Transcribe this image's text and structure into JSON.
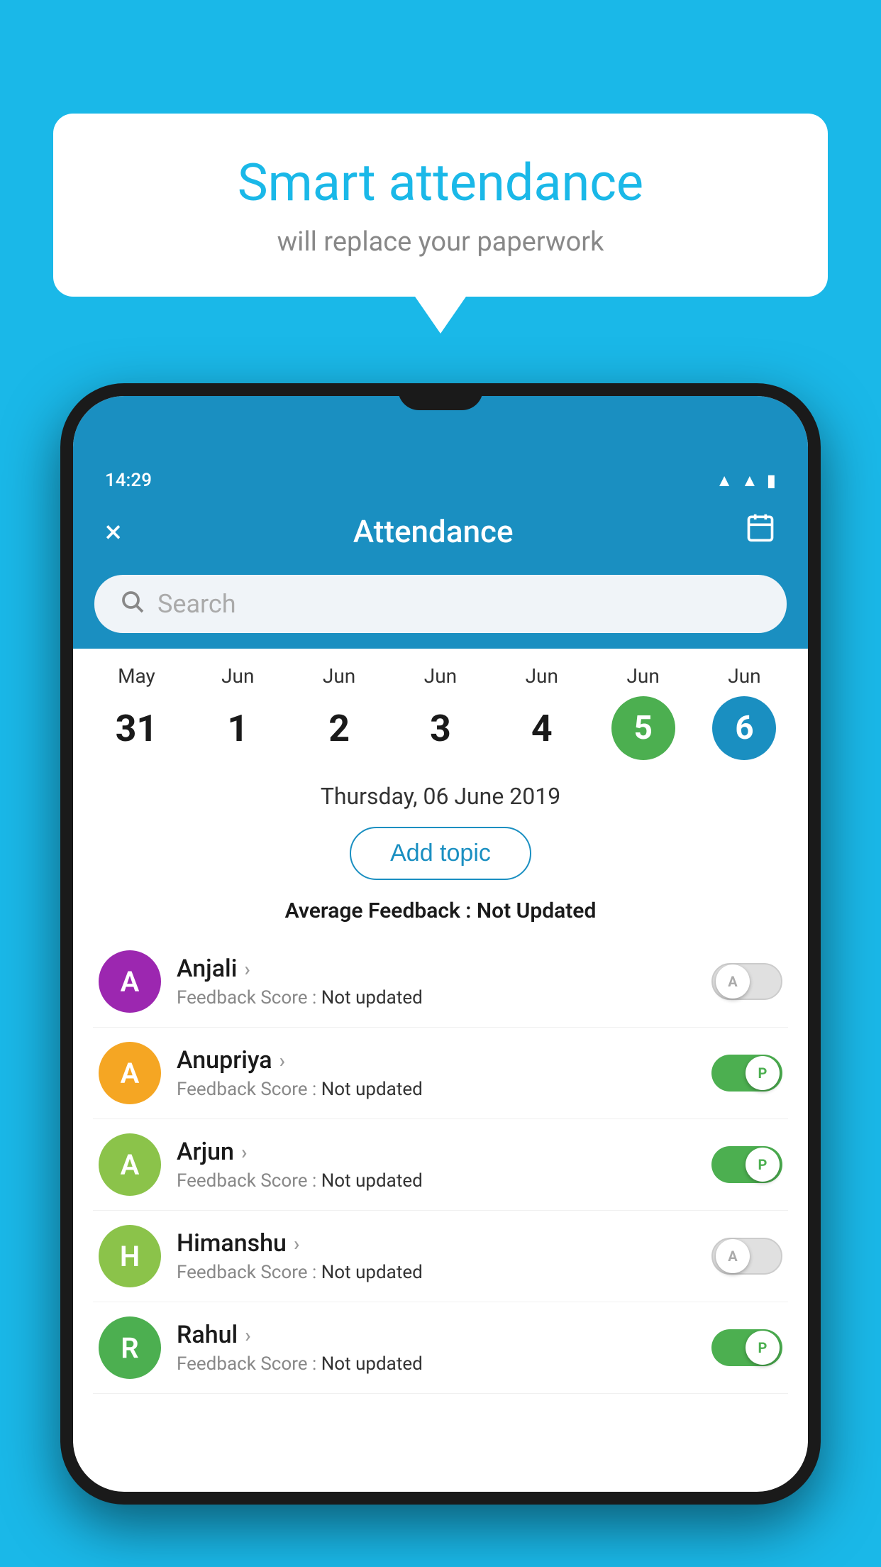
{
  "background_color": "#1ab8e8",
  "speech_bubble": {
    "title": "Smart attendance",
    "subtitle": "will replace your paperwork"
  },
  "phone": {
    "status_bar": {
      "time": "14:29",
      "icons": [
        "wifi",
        "signal",
        "battery"
      ]
    },
    "app_bar": {
      "title": "Attendance",
      "close_label": "×",
      "calendar_icon": "📅"
    },
    "search": {
      "placeholder": "Search"
    },
    "calendar": {
      "days": [
        {
          "month": "May",
          "date": "31",
          "state": "normal"
        },
        {
          "month": "Jun",
          "date": "1",
          "state": "normal"
        },
        {
          "month": "Jun",
          "date": "2",
          "state": "normal"
        },
        {
          "month": "Jun",
          "date": "3",
          "state": "normal"
        },
        {
          "month": "Jun",
          "date": "4",
          "state": "normal"
        },
        {
          "month": "Jun",
          "date": "5",
          "state": "today"
        },
        {
          "month": "Jun",
          "date": "6",
          "state": "selected"
        }
      ]
    },
    "selected_date": "Thursday, 06 June 2019",
    "add_topic_label": "Add topic",
    "feedback_label": "Average Feedback : ",
    "feedback_value": "Not Updated",
    "students": [
      {
        "name": "Anjali",
        "avatar_letter": "A",
        "avatar_color": "#9c27b0",
        "feedback_label": "Feedback Score : ",
        "feedback_value": "Not updated",
        "toggle_state": "off",
        "toggle_label": "A"
      },
      {
        "name": "Anupriya",
        "avatar_letter": "A",
        "avatar_color": "#f5a623",
        "feedback_label": "Feedback Score : ",
        "feedback_value": "Not updated",
        "toggle_state": "on",
        "toggle_label": "P"
      },
      {
        "name": "Arjun",
        "avatar_letter": "A",
        "avatar_color": "#8bc34a",
        "feedback_label": "Feedback Score : ",
        "feedback_value": "Not updated",
        "toggle_state": "on",
        "toggle_label": "P"
      },
      {
        "name": "Himanshu",
        "avatar_letter": "H",
        "avatar_color": "#8bc34a",
        "feedback_label": "Feedback Score : ",
        "feedback_value": "Not updated",
        "toggle_state": "off",
        "toggle_label": "A"
      },
      {
        "name": "Rahul",
        "avatar_letter": "R",
        "avatar_color": "#4caf50",
        "feedback_label": "Feedback Score : ",
        "feedback_value": "Not updated",
        "toggle_state": "on",
        "toggle_label": "P"
      }
    ]
  }
}
